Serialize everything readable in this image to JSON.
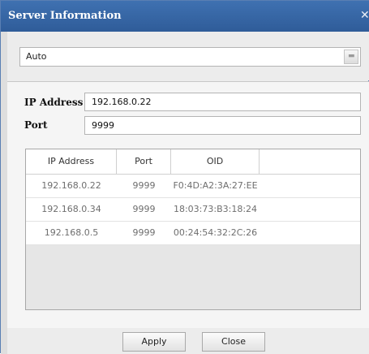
{
  "window": {
    "title": "Server Information",
    "close_glyph": "✕"
  },
  "mode_select": {
    "selected": "Auto",
    "arrow_glyph": "▬"
  },
  "form": {
    "ip_label": "IP Address",
    "ip_value": "192.168.0.22",
    "port_label": "Port",
    "port_value": "9999"
  },
  "server_table": {
    "columns": [
      "IP Address",
      "Port",
      "OID"
    ],
    "rows": [
      [
        "192.168.0.22",
        "9999",
        "F0:4D:A2:3A:27:EE"
      ],
      [
        "192.168.0.34",
        "9999",
        "18:03:73:B3:18:24"
      ],
      [
        "192.168.0.5",
        "9999",
        "00:24:54:32:2C:26"
      ]
    ]
  },
  "buttons": {
    "apply": "Apply",
    "close": "Close"
  }
}
